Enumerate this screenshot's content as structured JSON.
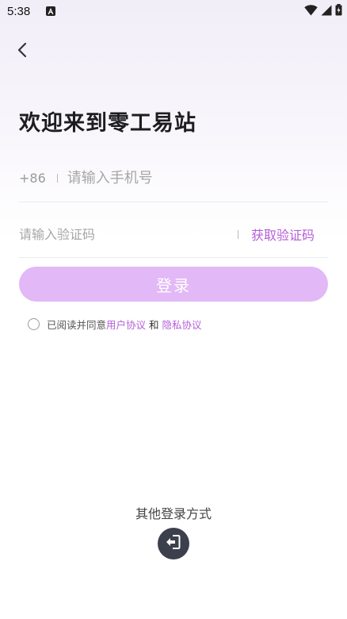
{
  "status_bar": {
    "time": "5:38",
    "app_icon": "notification-app-icon",
    "icons": [
      "wifi-icon",
      "cellular-signal-icon",
      "battery-charging-icon"
    ]
  },
  "header": {
    "back_icon": "chevron-left-icon"
  },
  "page": {
    "title": "欢迎来到零工易站"
  },
  "phone": {
    "country_code": "+86",
    "placeholder": "请输入手机号",
    "value": ""
  },
  "verification": {
    "placeholder": "请输入验证码",
    "value": "",
    "get_code_label": "获取验证码"
  },
  "login_button": {
    "label": "登录"
  },
  "agreement": {
    "checked": false,
    "prefix": "已阅读并同意",
    "user_agreement": "用户协议",
    "and": "和",
    "privacy_policy": "隐私协议"
  },
  "other_login": {
    "label": "其他登录方式",
    "icon": "logout-door-icon"
  },
  "colors": {
    "accent": "#b45ed8",
    "button_disabled": "#e2b8f6",
    "icon_bg": "#3c3f4c"
  }
}
